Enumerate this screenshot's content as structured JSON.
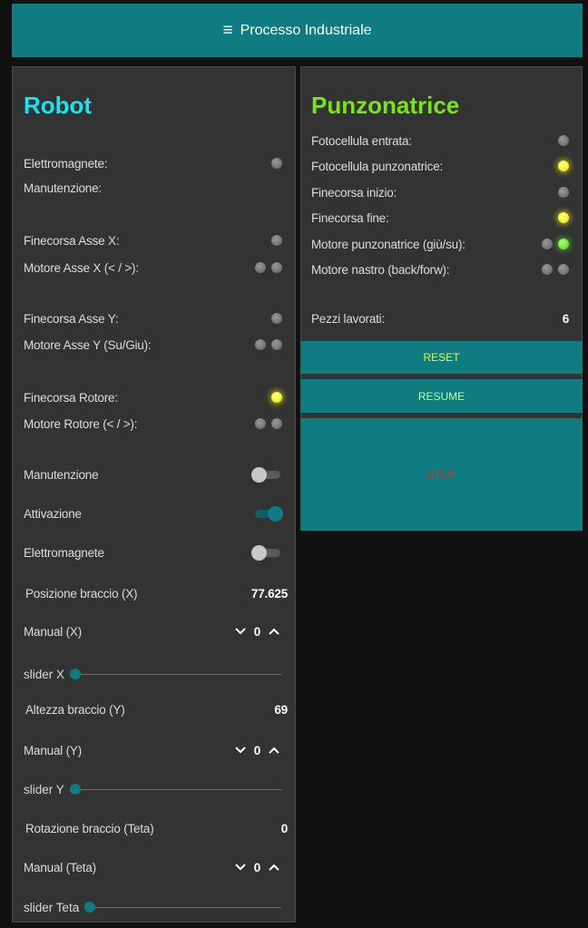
{
  "header": {
    "menu_icon": "menu-icon",
    "title": "Processo Industriale"
  },
  "robot": {
    "title": "Robot",
    "indicators": {
      "elettromagnete": {
        "label": "Elettromagnete:",
        "leds": [
          "off"
        ]
      },
      "manutenzione": {
        "label": "Manutenzione:"
      },
      "finecorsa_x": {
        "label": "Finecorsa Asse X:",
        "leds": [
          "off"
        ]
      },
      "motore_x": {
        "label": "Motore Asse X (< / >):",
        "leds": [
          "off",
          "off"
        ]
      },
      "finecorsa_y": {
        "label": "Finecorsa Asse Y:",
        "leds": [
          "off"
        ]
      },
      "motore_y": {
        "label": "Motore Asse Y (Su/Giu):",
        "leds": [
          "off",
          "off"
        ]
      },
      "finecorsa_rotore": {
        "label": "Finecorsa Rotore:",
        "leds": [
          "yellow"
        ]
      },
      "motore_rotore": {
        "label": "Motore Rotore (< / >):",
        "leds": [
          "off",
          "off"
        ]
      }
    },
    "switches": {
      "manutenzione": {
        "label": "Manutenzione",
        "on": false
      },
      "attivazione": {
        "label": "Attivazione",
        "on": true
      },
      "elettromagnete": {
        "label": "Elettromagnete",
        "on": false
      }
    },
    "posizione_x": {
      "label": "Posizione braccio (X)",
      "value": "77.625"
    },
    "manual_x": {
      "label": "Manual (X)",
      "value": "0"
    },
    "slider_x": {
      "label": "slider X",
      "value": 0
    },
    "altezza_y": {
      "label": "Altezza braccio (Y)",
      "value": "69"
    },
    "manual_y": {
      "label": "Manual (Y)",
      "value": "0"
    },
    "slider_y": {
      "label": "slider Y",
      "value": 0
    },
    "rotazione": {
      "label": "Rotazione braccio (Teta)",
      "value": "0"
    },
    "manual_teta": {
      "label": "Manual (Teta)",
      "value": "0"
    },
    "slider_teta": {
      "label": "slider Teta",
      "value": 0
    }
  },
  "punzonatrice": {
    "title": "Punzonatrice",
    "indicators": {
      "fotocellula_entrata": {
        "label": "Fotocellula entrata:",
        "leds": [
          "off"
        ]
      },
      "fotocellula_punz": {
        "label": "Fotocellula punzonatrice:",
        "leds": [
          "yellow"
        ]
      },
      "finecorsa_inizio": {
        "label": "Finecorsa inizio:",
        "leds": [
          "off"
        ]
      },
      "finecorsa_fine": {
        "label": "Finecorsa fine:",
        "leds": [
          "yellow"
        ]
      },
      "motore_punz": {
        "label": "Motore punzonatrice (giù/su):",
        "leds": [
          "off",
          "green"
        ]
      },
      "motore_nastro": {
        "label": "Motore nastro (back/forw):",
        "leds": [
          "off",
          "off"
        ]
      }
    },
    "pezzi": {
      "label": "Pezzi lavorati:",
      "value": "6"
    },
    "buttons": {
      "reset": "RESET",
      "resume": "RESUME",
      "stop": "STOP"
    }
  },
  "colors": {
    "accent": "#0e7c80",
    "robot_title": "#19e3f0",
    "punz_title": "#7be31a",
    "panel": "#333333",
    "background": "#111111"
  }
}
